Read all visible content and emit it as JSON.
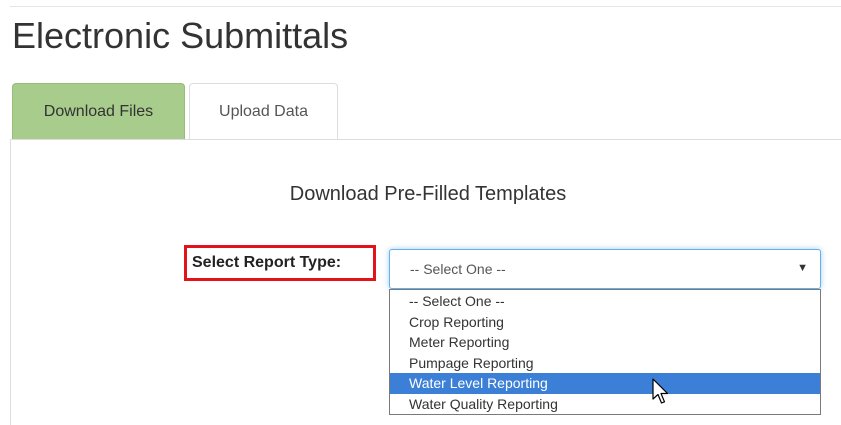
{
  "page": {
    "title": "Electronic Submittals"
  },
  "tabs": [
    {
      "label": "Download Files",
      "active": true
    },
    {
      "label": "Upload Data",
      "active": false
    }
  ],
  "download": {
    "heading": "Download Pre-Filled Templates",
    "report_type_label": "Select Report Type:",
    "select": {
      "current_value": "-- Select One --",
      "arrow_icon": "caret-down-icon",
      "options": [
        "-- Select One --",
        "Crop Reporting",
        "Meter Reporting",
        "Pumpage Reporting",
        "Water Level Reporting",
        "Water Quality Reporting"
      ],
      "highlighted_option": "Water Level Reporting"
    }
  },
  "colors": {
    "active_tab": "#a8cc8c",
    "highlight": "#3b7fd6",
    "label_outline": "#e1141c",
    "focus_border": "#66afe9"
  },
  "icons": {
    "pointer": "mouse-pointer-icon"
  }
}
